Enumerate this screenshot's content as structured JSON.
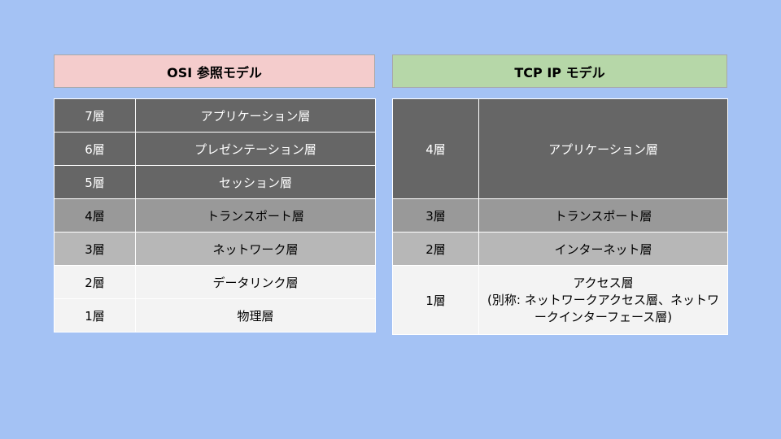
{
  "osi": {
    "title": "OSI 参照モデル",
    "layers": [
      {
        "num": "7層",
        "name": "アプリケーション層"
      },
      {
        "num": "6層",
        "name": "プレゼンテーション層"
      },
      {
        "num": "5層",
        "name": "セッション層"
      },
      {
        "num": "4層",
        "name": "トランスポート層"
      },
      {
        "num": "3層",
        "name": "ネットワーク層"
      },
      {
        "num": "2層",
        "name": "データリンク層"
      },
      {
        "num": "1層",
        "name": "物理層"
      }
    ]
  },
  "tcp": {
    "title": "TCP IP モデル",
    "layers": [
      {
        "num": "4層",
        "name": "アプリケーション層"
      },
      {
        "num": "3層",
        "name": "トランスポート層"
      },
      {
        "num": "2層",
        "name": "インターネット層"
      },
      {
        "num": "1層",
        "name": "アクセス層",
        "alias": "(別称: ネットワークアクセス層、ネットワークインターフェース層)"
      }
    ]
  },
  "colors": {
    "background": "#a4c2f4",
    "osi_header": "#f4cccc",
    "tcp_header": "#b6d7a8",
    "upper_layers": "#666666",
    "transport_layer": "#999999",
    "network_layer": "#b7b7b7",
    "lower_layers": "#f3f3f3"
  }
}
